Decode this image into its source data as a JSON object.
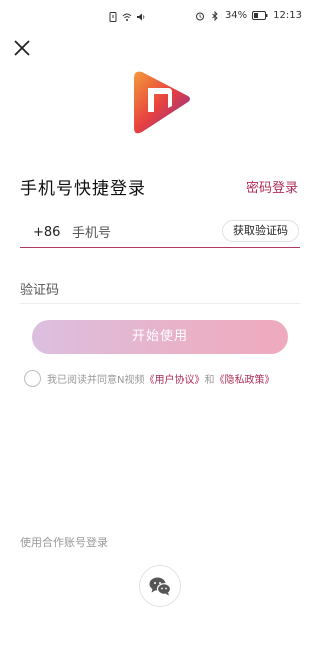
{
  "status_bar": {
    "battery": "34%",
    "time": "12:13"
  },
  "header": {
    "close_icon": "close-icon"
  },
  "login": {
    "title": "手机号快捷登录",
    "password_login_label": "密码登录",
    "country_code": "+86",
    "phone_placeholder": "手机号",
    "get_code_label": "获取验证码",
    "code_placeholder": "验证码",
    "start_button_label": "开始使用"
  },
  "agreement": {
    "prefix": "我已阅读并同意N视频",
    "user_agreement": "《用户协议》",
    "and": "和",
    "privacy_policy": "《隐私政策》"
  },
  "partner": {
    "label": "使用合作账号登录",
    "wechat_icon": "wechat-icon"
  },
  "colors": {
    "accent": "#b02e57",
    "button_gradient_start": "#dcbfe0",
    "button_gradient_end": "#efa9bd"
  }
}
